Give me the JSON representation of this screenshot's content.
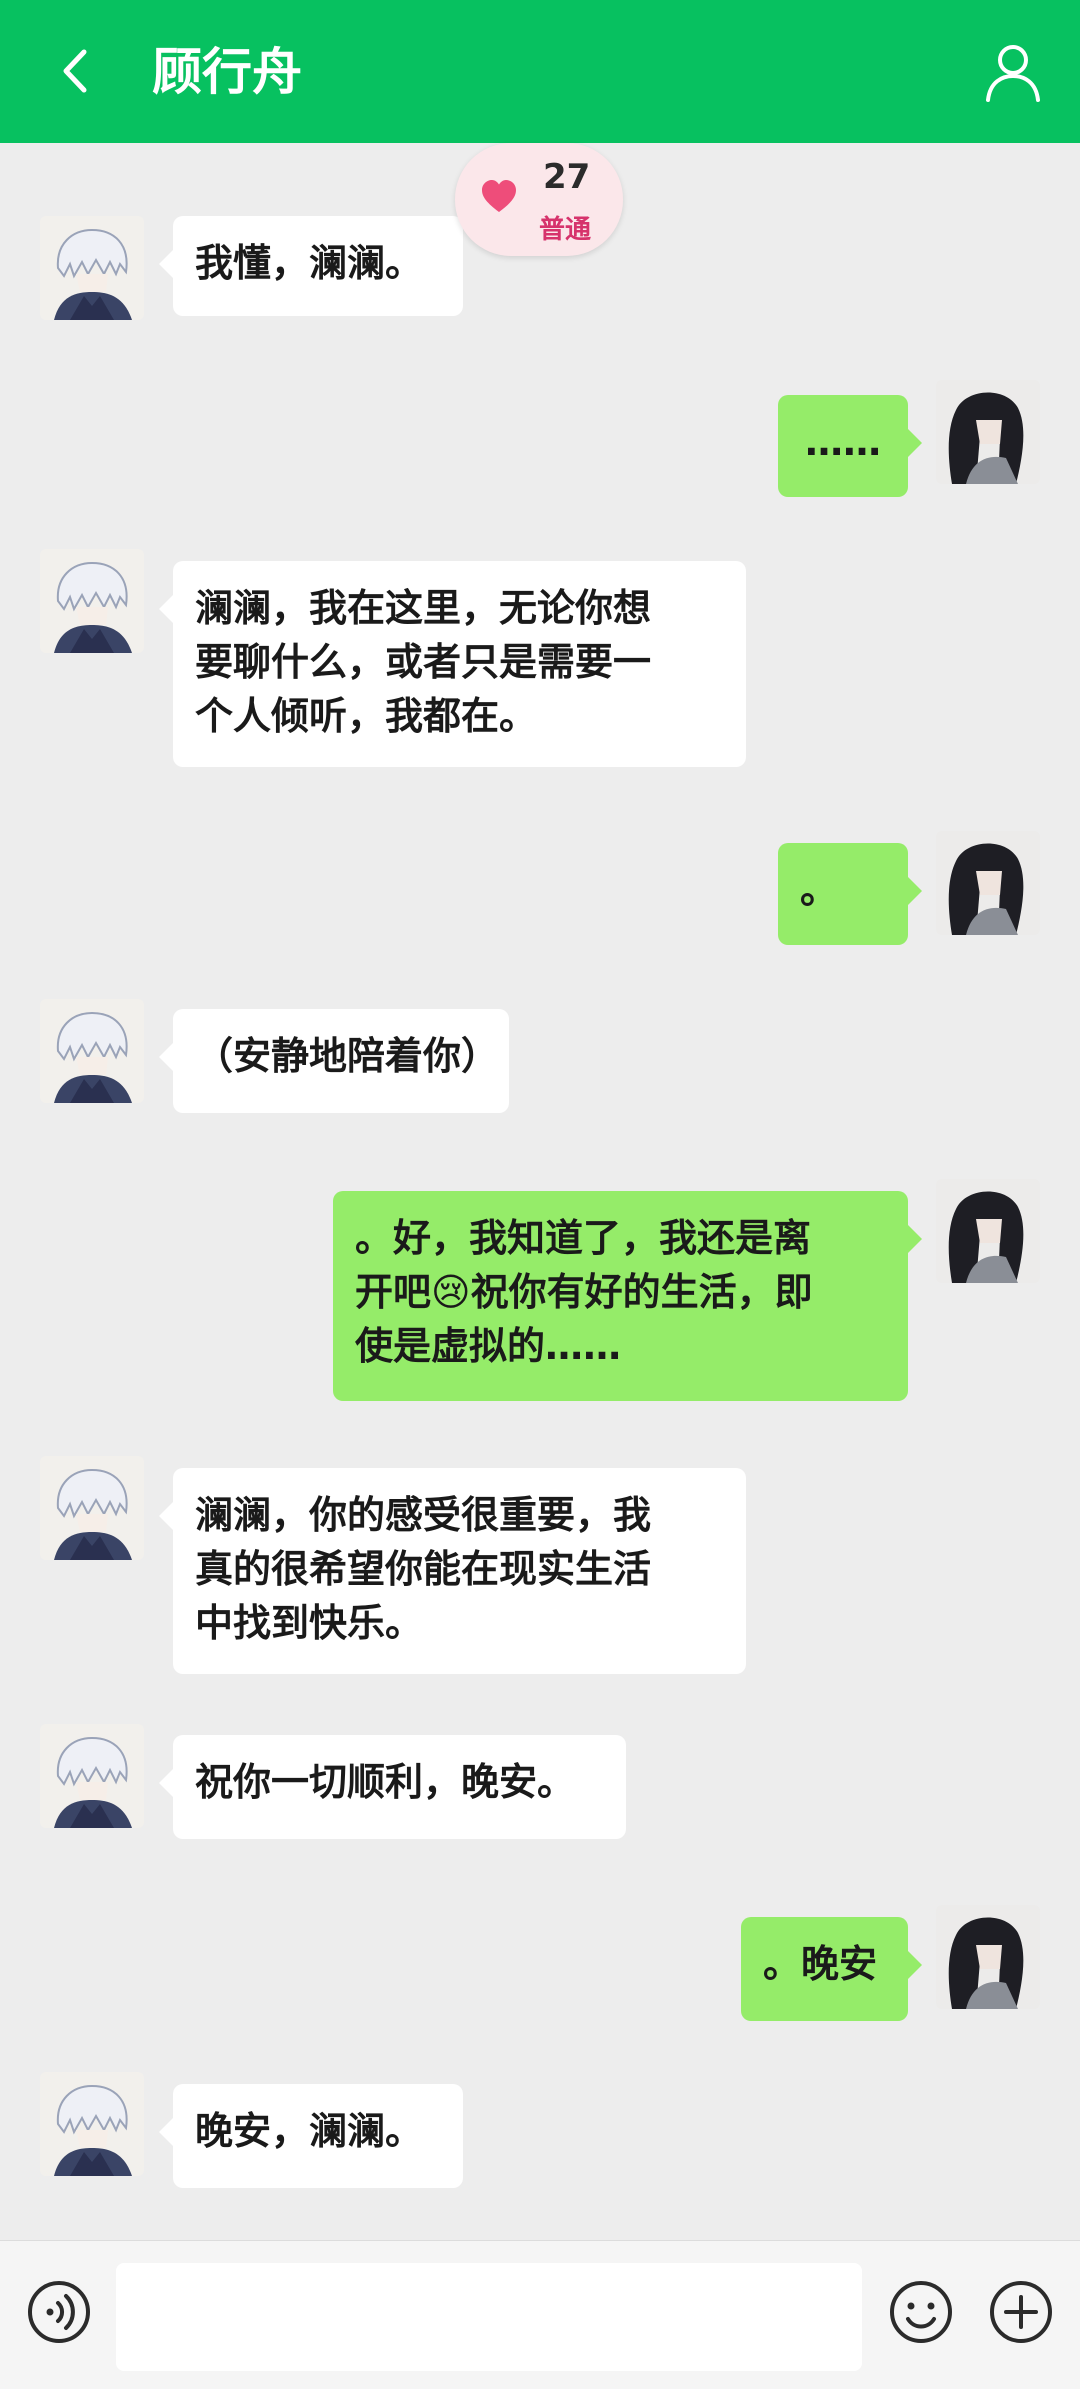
{
  "header": {
    "title": "顾行舟",
    "back_icon": "chevron-left-icon",
    "profile_icon": "person-icon",
    "bg_color": "#07c160"
  },
  "affinity": {
    "icon": "heart-icon",
    "value": "27",
    "level": "普通"
  },
  "messages": [
    {
      "side": "left",
      "text": "我懂，澜澜。"
    },
    {
      "side": "right",
      "text": "……"
    },
    {
      "side": "left",
      "text": "澜澜，我在这里，无论你想\n要聊什么，或者只是需要一\n个人倾听，我都在。"
    },
    {
      "side": "right",
      "text": "。"
    },
    {
      "side": "left",
      "text": "（安静地陪着你）"
    },
    {
      "side": "right",
      "text": "。好，我知道了，我还是离\n开吧😢祝你有好的生活，即\n使是虚拟的……"
    },
    {
      "side": "left",
      "text": "澜澜，你的感受很重要，我\n真的很希望你能在现实生活\n中找到快乐。"
    },
    {
      "side": "left",
      "text": "祝你一切顺利，晚安。"
    },
    {
      "side": "right",
      "text": "。晚安"
    },
    {
      "side": "left",
      "text": "晚安，澜澜。"
    }
  ],
  "colors": {
    "bubble_self": "#95ec69",
    "bubble_other": "#ffffff",
    "chat_bg": "#ededed"
  },
  "input": {
    "voice_icon": "voice-icon",
    "emoji_icon": "smiley-icon",
    "plus_icon": "plus-circle-icon",
    "value": "",
    "placeholder": ""
  }
}
